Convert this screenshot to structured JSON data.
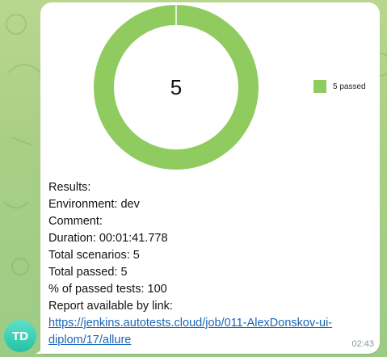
{
  "message": {
    "avatar_initials": "TD",
    "time": "02:43",
    "chart": {
      "center_value": "5",
      "legend_label": "5 passed",
      "passed_color": "#8fcb5f"
    },
    "lines": [
      {
        "label": "Results:",
        "value": ""
      },
      {
        "label": "Environment:",
        "value": " dev"
      },
      {
        "label": "Comment:",
        "value": ""
      },
      {
        "label": "Duration:",
        "value": " 00:01:41.778"
      },
      {
        "label": "Total scenarios:",
        "value": " 5"
      },
      {
        "label": "Total passed:",
        "value": " 5"
      },
      {
        "label": "% of passed tests:",
        "value": " 100"
      },
      {
        "label": "Report available by link:",
        "value": ""
      }
    ],
    "link_line1": "https://jenkins.autotests.cloud/job/011-AlexDonskov-ui-",
    "link_line2": "diplom/17/allure"
  },
  "chart_data": {
    "type": "pie",
    "categories": [
      "passed"
    ],
    "values": [
      5
    ],
    "title": "",
    "center_label": "5",
    "legend": [
      "5 passed"
    ]
  }
}
